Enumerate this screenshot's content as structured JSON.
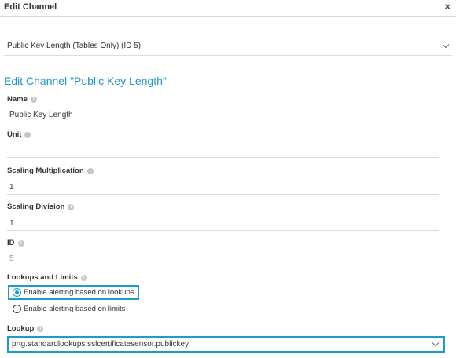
{
  "dialog": {
    "title": "Edit Channel",
    "close_symbol": "×",
    "channel_select_value": "Public Key Length (Tables Only) (ID 5)",
    "heading": "Edit Channel \"Public Key Length\""
  },
  "fields": {
    "name": {
      "label": "Name",
      "value": "Public Key Length"
    },
    "unit": {
      "label": "Unit",
      "value": ""
    },
    "scaling_multiplication": {
      "label": "Scaling Multiplication",
      "value": "1"
    },
    "scaling_division": {
      "label": "Scaling Division",
      "value": "1"
    },
    "id": {
      "label": "ID",
      "value": "5"
    }
  },
  "lookups_and_limits": {
    "label": "Lookups and Limits",
    "options": [
      {
        "label": "Enable alerting based on lookups",
        "checked": true
      },
      {
        "label": "Enable alerting based on limits",
        "checked": false
      }
    ]
  },
  "lookup": {
    "label": "Lookup",
    "value": "prtg.standardlookups.sslcertificatesensor.publickey"
  },
  "icons": {
    "info": "i",
    "close": "close-icon",
    "dropdown": "chevron-down-icon"
  },
  "colors": {
    "accent": "#1e9bc9",
    "heading": "#1f95c4"
  }
}
